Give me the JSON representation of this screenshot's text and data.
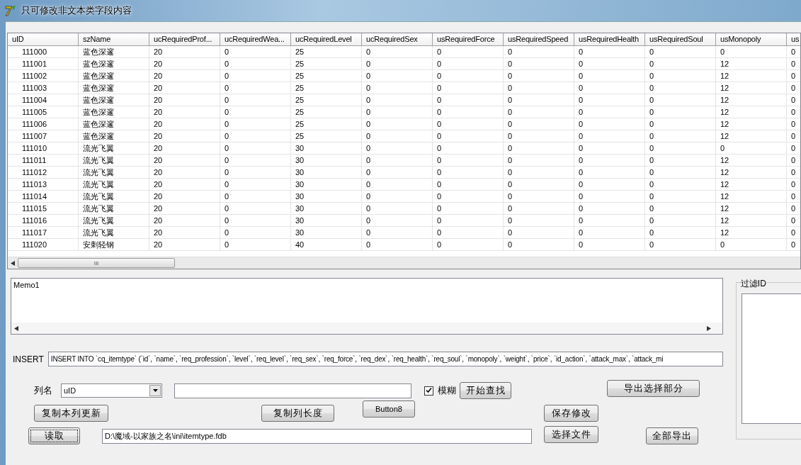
{
  "window": {
    "title": "只可修改非文本类字段内容"
  },
  "table": {
    "columns": [
      "uID",
      "szName",
      "ucRequiredProf...",
      "ucRequiredWea...",
      "ucRequiredLevel",
      "ucRequiredSex",
      "usRequiredForce",
      "usRequiredSpeed",
      "usRequiredHealth",
      "usRequiredSoul",
      "usMonopoly",
      "us"
    ],
    "rows": [
      [
        "111000",
        "蓝色深邃",
        "20",
        "0",
        "25",
        "0",
        "0",
        "0",
        "0",
        "0",
        "0",
        "0"
      ],
      [
        "111001",
        "蓝色深邃",
        "20",
        "0",
        "25",
        "0",
        "0",
        "0",
        "0",
        "0",
        "12",
        "0"
      ],
      [
        "111002",
        "蓝色深邃",
        "20",
        "0",
        "25",
        "0",
        "0",
        "0",
        "0",
        "0",
        "12",
        "0"
      ],
      [
        "111003",
        "蓝色深邃",
        "20",
        "0",
        "25",
        "0",
        "0",
        "0",
        "0",
        "0",
        "12",
        "0"
      ],
      [
        "111004",
        "蓝色深邃",
        "20",
        "0",
        "25",
        "0",
        "0",
        "0",
        "0",
        "0",
        "12",
        "0"
      ],
      [
        "111005",
        "蓝色深邃",
        "20",
        "0",
        "25",
        "0",
        "0",
        "0",
        "0",
        "0",
        "12",
        "0"
      ],
      [
        "111006",
        "蓝色深邃",
        "20",
        "0",
        "25",
        "0",
        "0",
        "0",
        "0",
        "0",
        "12",
        "0"
      ],
      [
        "111007",
        "蓝色深邃",
        "20",
        "0",
        "25",
        "0",
        "0",
        "0",
        "0",
        "0",
        "12",
        "0"
      ],
      [
        "111010",
        "流光飞翼",
        "20",
        "0",
        "30",
        "0",
        "0",
        "0",
        "0",
        "0",
        "0",
        "0"
      ],
      [
        "111011",
        "流光飞翼",
        "20",
        "0",
        "30",
        "0",
        "0",
        "0",
        "0",
        "0",
        "12",
        "0"
      ],
      [
        "111012",
        "流光飞翼",
        "20",
        "0",
        "30",
        "0",
        "0",
        "0",
        "0",
        "0",
        "12",
        "0"
      ],
      [
        "111013",
        "流光飞翼",
        "20",
        "0",
        "30",
        "0",
        "0",
        "0",
        "0",
        "0",
        "12",
        "0"
      ],
      [
        "111014",
        "流光飞翼",
        "20",
        "0",
        "30",
        "0",
        "0",
        "0",
        "0",
        "0",
        "12",
        "0"
      ],
      [
        "111015",
        "流光飞翼",
        "20",
        "0",
        "30",
        "0",
        "0",
        "0",
        "0",
        "0",
        "12",
        "0"
      ],
      [
        "111016",
        "流光飞翼",
        "20",
        "0",
        "30",
        "0",
        "0",
        "0",
        "0",
        "0",
        "12",
        "0"
      ],
      [
        "111017",
        "流光飞翼",
        "20",
        "0",
        "30",
        "0",
        "0",
        "0",
        "0",
        "0",
        "12",
        "0"
      ],
      [
        "111020",
        "安刺轻钢",
        "20",
        "0",
        "40",
        "0",
        "0",
        "0",
        "0",
        "0",
        "0",
        "0"
      ]
    ],
    "scroll_thumb_label": "III"
  },
  "memo": {
    "value": "Memo1"
  },
  "filter_group": {
    "label": "过滤ID"
  },
  "insert": {
    "label": "INSERT",
    "value": "INSERT INTO `cq_itemtype` (`id`, `name`, `req_profession`, `level`, `req_level`, `req_sex`, `req_force`, `req_dex`, `req_health`, `req_soul`, `monopoly`, `weight`, `price`, `id_action`, `attack_max`, `attack_mi"
  },
  "column_select": {
    "label": "列名",
    "value": "uID"
  },
  "fuzzy": {
    "label": "模糊",
    "checked": true
  },
  "buttons": {
    "find": "开始查找",
    "export_selected": "导出选择部分",
    "copy_update": "复制本列更新",
    "copy_length": "复制列长度",
    "button8": "Button8",
    "save": "保存修改",
    "read": "读取",
    "choose_file": "选择文件",
    "export_all": "全部导出"
  },
  "file_path": {
    "value": "D:\\魔域-以家族之名\\ini\\itemtype.fdb"
  }
}
